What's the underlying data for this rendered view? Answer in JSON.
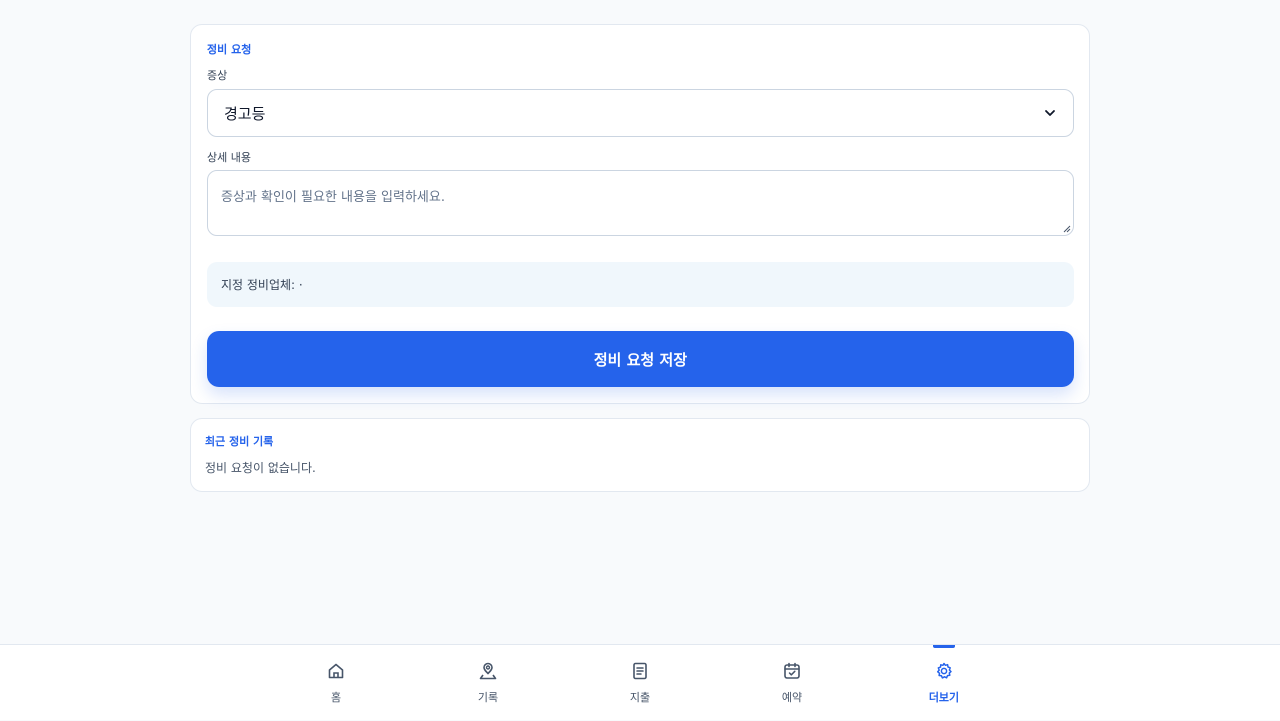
{
  "maintenance_form": {
    "title": "정비 요청",
    "symptom_label": "증상",
    "symptom_value": "경고등",
    "detail_label": "상세 내용",
    "detail_placeholder": "증상과 확인이 필요한 내용을 입력하세요.",
    "assigned_shop": "지정 정비업체: ·",
    "submit_label": "정비 요청 저장"
  },
  "history": {
    "title": "최근 정비 기록",
    "empty_text": "정비 요청이 없습니다."
  },
  "nav": {
    "items": [
      {
        "label": "홈",
        "icon": "home-icon"
      },
      {
        "label": "기록",
        "icon": "map-pin-icon"
      },
      {
        "label": "지출",
        "icon": "receipt-icon"
      },
      {
        "label": "예약",
        "icon": "calendar-check-icon"
      },
      {
        "label": "더보기",
        "icon": "gear-icon",
        "active": true
      }
    ]
  },
  "colors": {
    "accent": "#2563eb",
    "background": "#f8fafc",
    "info_background": "#f0f7fc"
  }
}
